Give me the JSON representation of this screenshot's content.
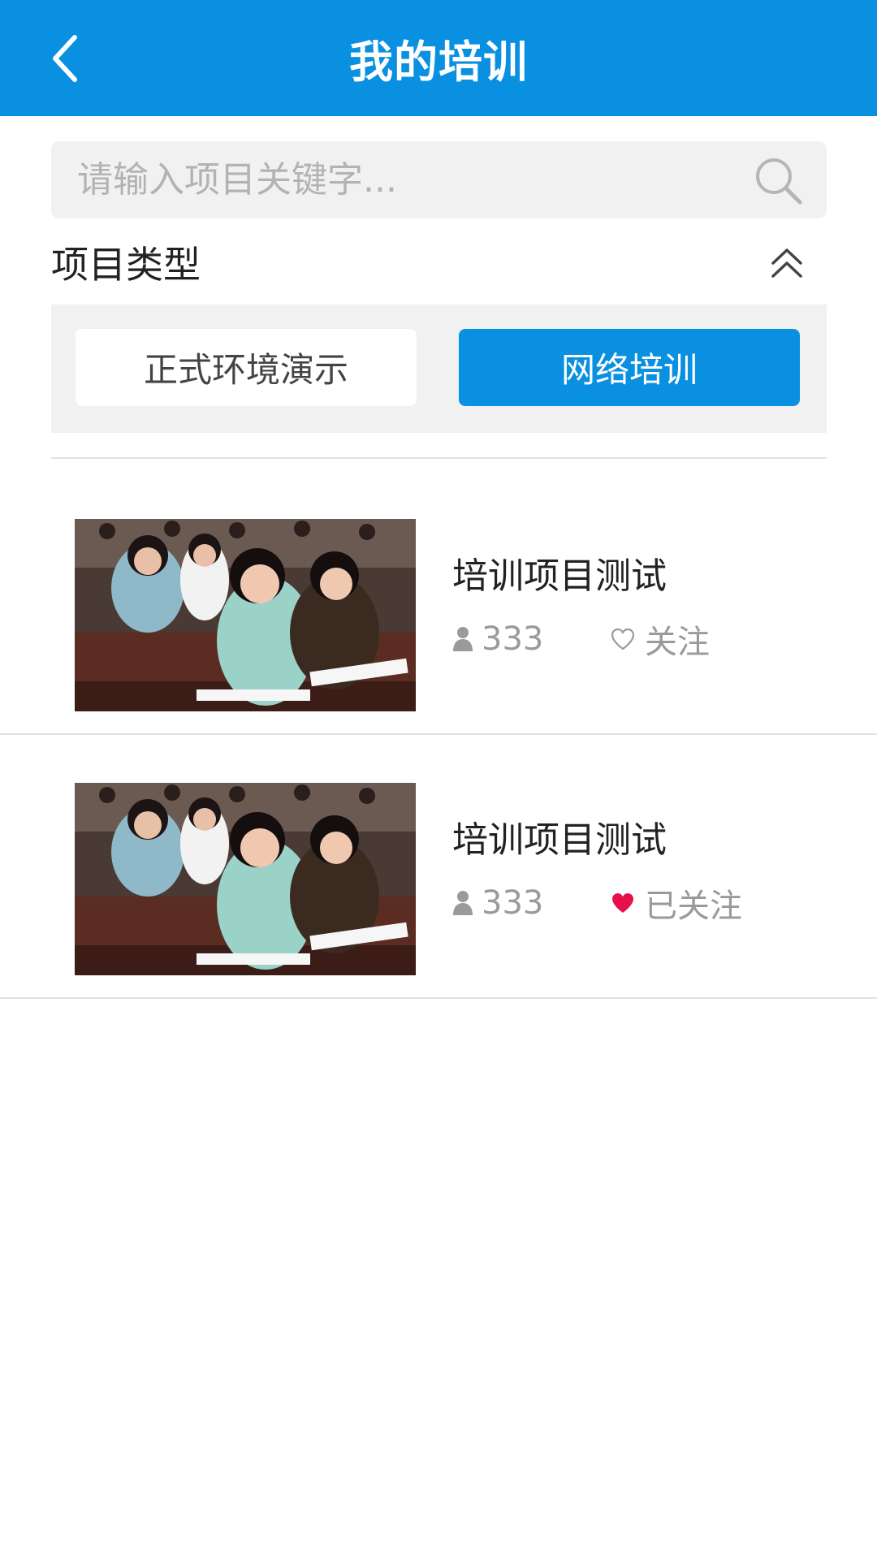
{
  "header": {
    "title": "我的培训"
  },
  "search": {
    "placeholder": "请输入项目关键字..."
  },
  "filter": {
    "section_title": "项目类型",
    "types": [
      {
        "label": "正式环境演示",
        "selected": false
      },
      {
        "label": "网络培训",
        "selected": true
      }
    ]
  },
  "list": {
    "items": [
      {
        "title": "培训项目测试",
        "count": "333",
        "follow_label": "关注",
        "followed": false
      },
      {
        "title": "培训项目测试",
        "count": "333",
        "follow_label": "已关注",
        "followed": true
      }
    ]
  },
  "colors": {
    "primary": "#0a90e0",
    "followed_heart": "#e8104a"
  }
}
